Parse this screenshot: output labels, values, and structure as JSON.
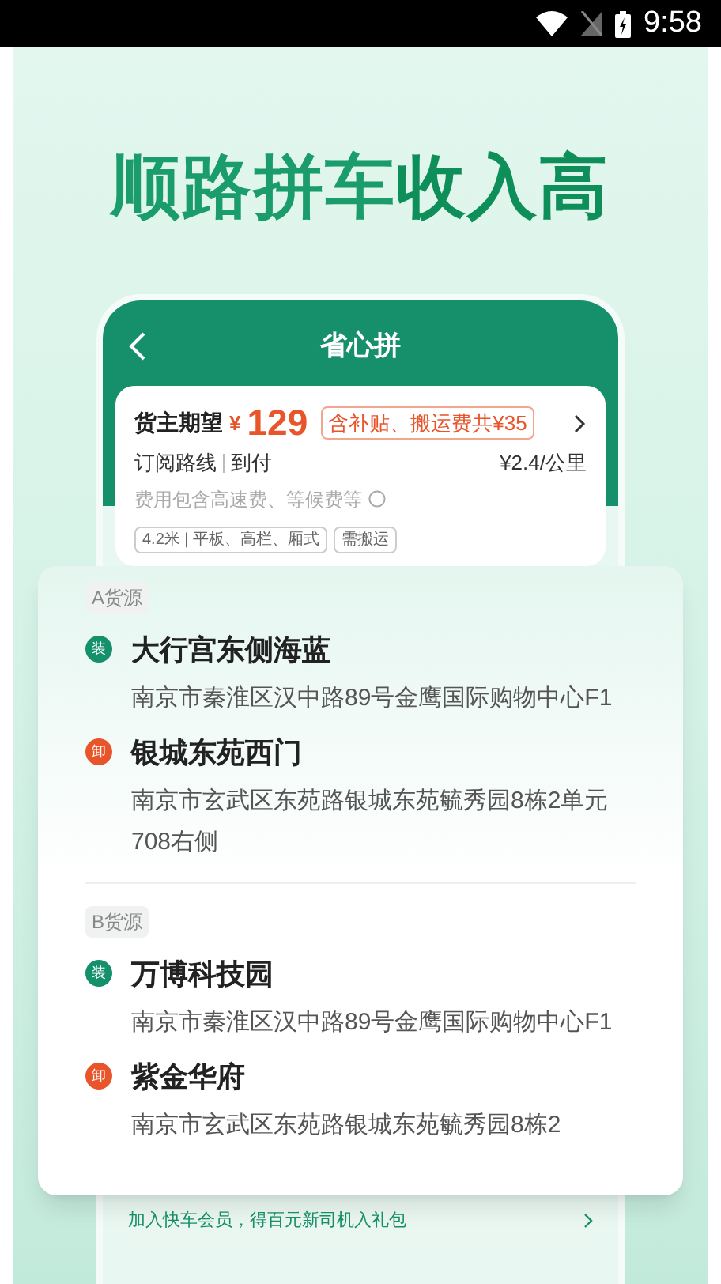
{
  "status_bar": {
    "time": "9:58"
  },
  "headline": {
    "lead": "顺路拼车",
    "accent": "收入高"
  },
  "phone": {
    "title": "省心拼",
    "order": {
      "label": "货主期望",
      "currency": "¥",
      "amount": "129",
      "subsidy": "含补贴、搬运费共¥35",
      "route": "订阅路线",
      "payment": "到付",
      "rate": "¥2.4/公里",
      "note": "费用包含高速费、等候费等",
      "tags": [
        "4.2米 | 平板、高栏、厢式",
        "需搬运"
      ]
    },
    "banner": "加入快车会员，得百元新司机入礼包"
  },
  "sources": [
    {
      "label": "A货源",
      "stops": [
        {
          "kind": "load",
          "badge": "装",
          "name": "大行宫东侧海蓝",
          "address": "南京市秦淮区汉中路89号金鹰国际购物中心F1"
        },
        {
          "kind": "unload",
          "badge": "卸",
          "name": "银城东苑西门",
          "address": "南京市玄武区东苑路银城东苑毓秀园8栋2单元708右侧"
        }
      ]
    },
    {
      "label": "B货源",
      "stops": [
        {
          "kind": "load",
          "badge": "装",
          "name": "万博科技园",
          "address": "南京市秦淮区汉中路89号金鹰国际购物中心F1"
        },
        {
          "kind": "unload",
          "badge": "卸",
          "name": "紫金华府",
          "address": "南京市玄武区东苑路银城东苑毓秀园8栋2"
        }
      ]
    }
  ]
}
